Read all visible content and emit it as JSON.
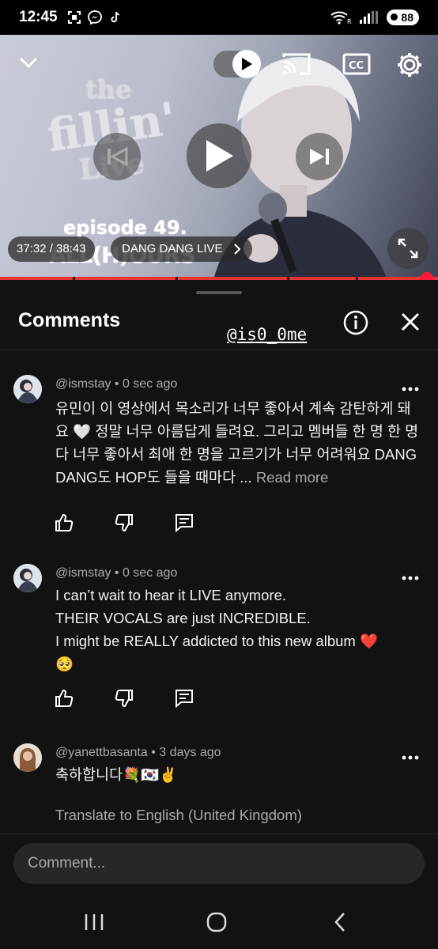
{
  "status_bar": {
    "time": "12:45",
    "battery": "88",
    "icons": [
      "screenshot-icon",
      "messenger-icon",
      "tiktok-icon",
      "wifi-icon",
      "signal-icon",
      "battery-icon"
    ]
  },
  "video": {
    "logo": {
      "the": "the",
      "fillin": "fillin'",
      "live": "Live",
      "episode": "episode 49.",
      "hours": "ALL(H)OURS"
    },
    "time_display": "37:32 / 38:43",
    "chapter": "DANG DANG LIVE",
    "progress_fraction": 0.974,
    "accent_color": "#ff0033"
  },
  "comments_panel": {
    "title": "Comments",
    "watermark": "@is0_0me",
    "comments": [
      {
        "author": "@ismstay",
        "time": "0 sec ago",
        "meta": "@ismstay • 0 sec ago",
        "text": "유민이 이 영상에서 목소리가 너무 좋아서 계속 감탄하게 돼요 🤍 정말 너무 아름답게 들려요. 그리고 멤버들 한 명 한 명 다 너무 좋아서 최애 한 명을 고르기가 너무 어려워요  DANG DANG도 HOP도 들을 때마다 ...",
        "read_more": "Read more"
      },
      {
        "author": "@ismstay",
        "time": "0 sec ago",
        "meta": "@ismstay • 0 sec ago",
        "lines": [
          "I can’t wait to hear it LIVE anymore.",
          "THEIR VOCALS are just INCREDIBLE.",
          "I might be REALLY addicted to this new album ❤️",
          "🥺"
        ]
      },
      {
        "author": "@yanettbasanta",
        "time": "3 days ago",
        "meta": "@yanettbasanta • 3 days ago",
        "text": "축하합니다💐🇰🇷✌️",
        "translate": "Translate to English (United Kingdom)"
      }
    ],
    "composer_placeholder": "Comment..."
  }
}
